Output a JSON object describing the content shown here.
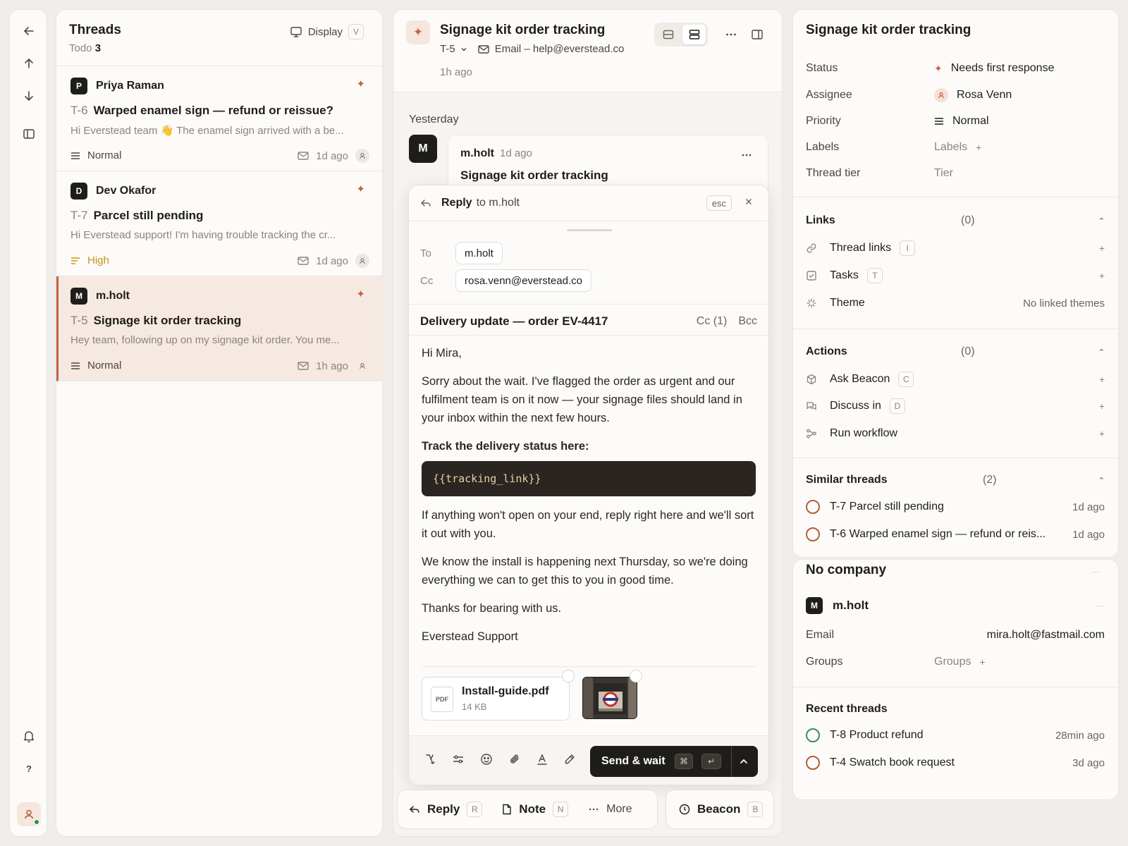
{
  "rail": {
    "icons": [
      "back-arrow-icon",
      "arrow-up-icon",
      "arrow-down-icon",
      "sidebar-icon",
      "bell-icon",
      "help-icon",
      "user-icon"
    ],
    "help_label": "?"
  },
  "threads": {
    "title": "Threads",
    "sub_label": "Todo",
    "sub_count": "3",
    "display_label": "Display",
    "display_key": "V",
    "items": [
      {
        "initial": "P",
        "name": "Priya Raman",
        "id": "T-6",
        "subject": "Warped enamel sign — refund or reissue?",
        "preview": "Hi Everstead team 👋 The enamel sign arrived with a be...",
        "priority": "Normal",
        "time": "1d ago",
        "active": false
      },
      {
        "initial": "D",
        "name": "Dev Okafor",
        "id": "T-7",
        "subject": "Parcel still pending",
        "preview": "Hi Everstead support! I'm having trouble tracking the cr...",
        "priority": "High",
        "time": "1d ago",
        "active": false
      },
      {
        "initial": "M",
        "name": "m.holt",
        "id": "T-5",
        "subject": "Signage kit order tracking",
        "preview": "Hey team, following up on my signage kit order. You me...",
        "priority": "Normal",
        "time": "1h ago",
        "active": true
      }
    ]
  },
  "convo": {
    "title": "Signage kit order tracking",
    "ticket": "T-5",
    "channel": "Email – help@everstead.co",
    "time": "1h ago",
    "day_label": "Yesterday",
    "message": {
      "initial": "M",
      "author": "m.holt",
      "when": "1d ago",
      "title": "Signage kit order tracking"
    },
    "composer": {
      "reply_label": "Reply",
      "reply_to": "to m.holt",
      "esc_label": "esc",
      "to_label": "To",
      "to_value": "m.holt",
      "cc_label": "Cc",
      "cc_value": "rosa.venn@everstead.co",
      "subject": "Delivery update — order EV-4417",
      "cc_toggle": "Cc (1)",
      "bcc_toggle": "Bcc",
      "greeting": "Hi Mira,",
      "para1": "Sorry about the wait. I've flagged the order as urgent and our fulfilment team is on it now — your signage files should land in your inbox within the next few hours.",
      "track_label": "Track the delivery status here:",
      "code": "{{tracking_link}}",
      "para2": "If anything won't open on your end, reply right here and we'll sort it out with you.",
      "para3": "We know the install is happening next Thursday, so we're doing everything we can to get this to you in good time.",
      "para4": "Thanks for bearing with us.",
      "signature": "Everstead Support",
      "attachment": {
        "type_label": "PDF",
        "name": "Install-guide.pdf",
        "size": "14 KB"
      },
      "send_label": "Send & wait",
      "send_key1": "⌘",
      "send_key2": "↵"
    },
    "bottom": {
      "reply": "Reply",
      "reply_key": "R",
      "note": "Note",
      "note_key": "N",
      "more": "More",
      "beacon": "Beacon",
      "beacon_key": "B"
    }
  },
  "details": {
    "title": "Signage kit order tracking",
    "props": [
      {
        "key": "Status",
        "value": "Needs first response",
        "icon": "spark-icon"
      },
      {
        "key": "Assignee",
        "value": "Rosa Venn",
        "icon": "user-icon"
      },
      {
        "key": "Priority",
        "value": "Normal",
        "icon": "priority-lines-icon"
      },
      {
        "key": "Labels",
        "value": "Labels",
        "icon": "plus-icon"
      },
      {
        "key": "Thread tier",
        "value": "Tier",
        "icon": ""
      }
    ],
    "links": {
      "title": "Links",
      "count": "(0)",
      "items": [
        {
          "label": "Thread links",
          "key": "I",
          "icon": "link-icon"
        },
        {
          "label": "Tasks",
          "key": "T",
          "icon": "checkbox-icon"
        },
        {
          "label": "Theme",
          "right": "No linked themes",
          "icon": "sparkle-icon"
        }
      ]
    },
    "actions": {
      "title": "Actions",
      "count": "(0)",
      "items": [
        {
          "label": "Ask Beacon",
          "key": "C",
          "icon": "cube-icon"
        },
        {
          "label": "Discuss in",
          "key": "D",
          "icon": "chat-icon"
        },
        {
          "label": "Run workflow",
          "icon": "workflow-icon"
        }
      ]
    },
    "similar": {
      "title": "Similar threads",
      "count": "(2)",
      "items": [
        {
          "label": "T-7 Parcel still pending",
          "time": "1d ago"
        },
        {
          "label": "T-6 Warped enamel sign — refund or reis...",
          "time": "1d ago"
        }
      ]
    }
  },
  "company": {
    "title": "No company",
    "contact_initial": "M",
    "contact_name": "m.holt",
    "email_label": "Email",
    "email_value": "mira.holt@fastmail.com",
    "groups_label": "Groups",
    "groups_value": "Groups",
    "recent_title": "Recent threads",
    "recent": [
      {
        "label": "T-8 Product refund",
        "time": "28min ago",
        "color": "#3f8a5c"
      },
      {
        "label": "T-4 Swatch book request",
        "time": "3d ago",
        "color": "#b85a3c"
      }
    ]
  }
}
